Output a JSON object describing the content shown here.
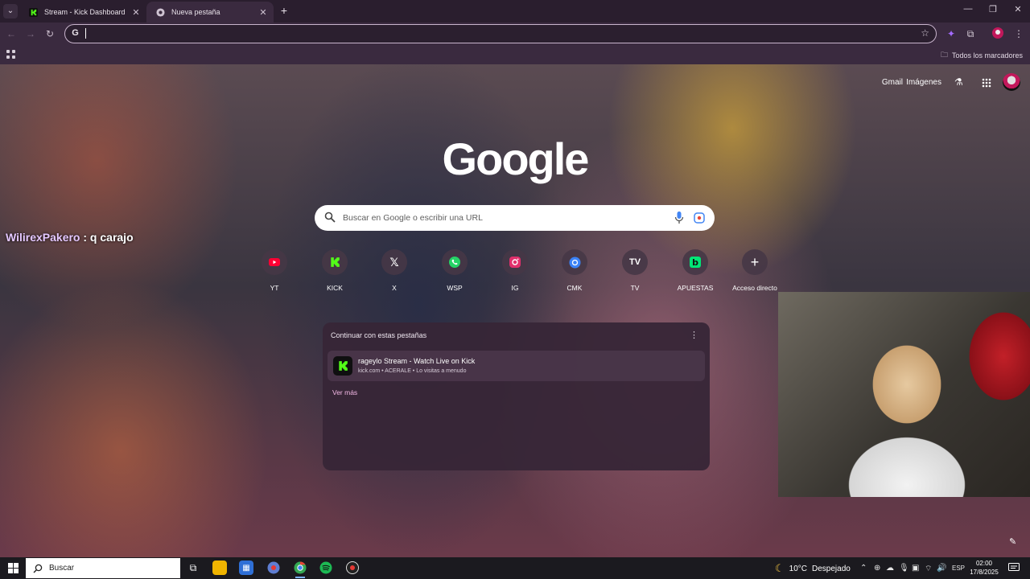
{
  "browser": {
    "tabs": [
      {
        "title": "Stream - Kick Dashboard",
        "active": false
      },
      {
        "title": "Nueva pestaña",
        "active": true
      }
    ],
    "omnibox_value": "",
    "all_bookmarks_label": "Todos los marcadores"
  },
  "newtab": {
    "top_links": {
      "gmail": "Gmail",
      "images": "Imágenes"
    },
    "logo": "Google",
    "search_placeholder": "Buscar en Google o escribir una URL",
    "shortcuts": [
      {
        "label": "YT",
        "icon": "youtube-icon",
        "color": "#ff0033"
      },
      {
        "label": "KICK",
        "icon": "kick-icon",
        "color": "#53fc18"
      },
      {
        "label": "X",
        "icon": "x-icon",
        "color": "#ffffff"
      },
      {
        "label": "WSP",
        "icon": "whatsapp-icon",
        "color": "#25d366"
      },
      {
        "label": "IG",
        "icon": "instagram-icon",
        "color": "#e1306c"
      },
      {
        "label": "CMK",
        "icon": "messenger-icon",
        "color": "#3b82f6"
      },
      {
        "label": "TV",
        "icon": "tradingview-icon",
        "color": "#ffffff"
      },
      {
        "label": "APUESTAS",
        "icon": "bet-icon",
        "color": "#00e676"
      },
      {
        "label": "Acceso directo",
        "icon": "plus-icon",
        "color": "#ffffff"
      }
    ],
    "continue_card": {
      "heading": "Continuar con estas pestañas",
      "item_title": "rageylo Stream - Watch Live on Kick",
      "item_subtitle": "kick.com • ACERALE • Lo visitas a menudo",
      "see_more": "Ver más"
    }
  },
  "overlay": {
    "chat_user": "WilirexPakero",
    "chat_message": " : q carajo"
  },
  "taskbar": {
    "search_label": "Buscar",
    "weather_temp": "10°C",
    "weather_desc": "Despejado",
    "language": "ESP",
    "time": "02:00",
    "date": "17/8/2025"
  }
}
